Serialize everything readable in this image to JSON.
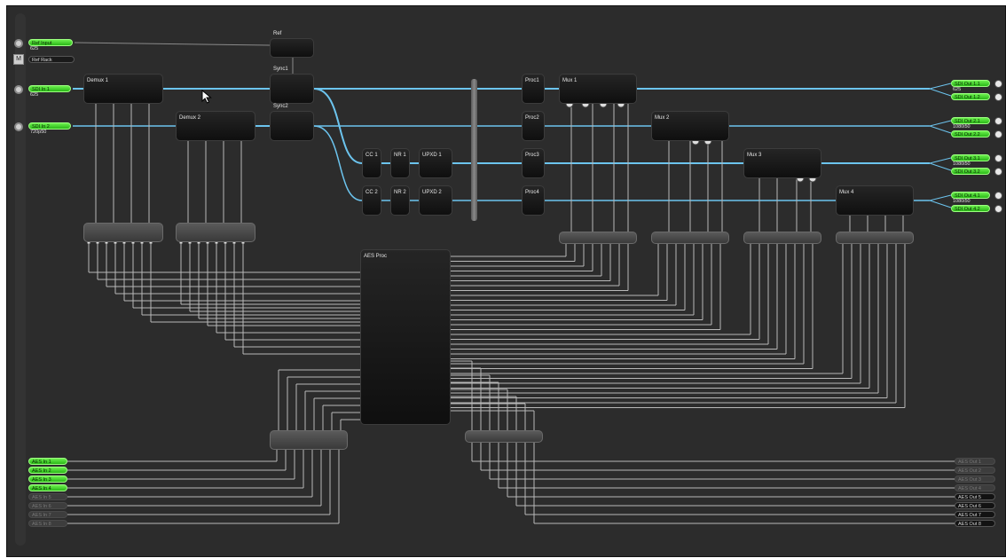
{
  "inputs": {
    "ref_input": {
      "label": "Ref Input",
      "sub": "625"
    },
    "ref_rack": {
      "label": "Ref Rack"
    },
    "sdi_in_1": {
      "label": "SDI In 1",
      "sub": "625"
    },
    "sdi_in_2": {
      "label": "SDI In 2",
      "sub": "720p50"
    }
  },
  "processors": {
    "ref": "Ref",
    "sync1": "Sync1",
    "sync2": "Sync2",
    "demux1": "Demux 1",
    "demux2": "Demux 2",
    "cc1": "CC 1",
    "nr1": "NR 1",
    "upxd1": "UPXD 1",
    "cc2": "CC 2",
    "nr2": "NR 2",
    "upxd2": "UPXD 2",
    "proc1": "Proc1",
    "proc2": "Proc2",
    "proc3": "Proc3",
    "proc4": "Proc4",
    "mux1": "Mux 1",
    "mux2": "Mux 2",
    "mux3": "Mux 3",
    "mux4": "Mux 4",
    "aes_proc": "AES Proc"
  },
  "outputs": [
    {
      "a": "SDI Out 1.1",
      "b": "SDI Out 1.2",
      "sub": "625"
    },
    {
      "a": "SDI Out 2.1",
      "b": "SDI Out 2.2",
      "sub": "1080i50"
    },
    {
      "a": "SDI Out 3.1",
      "b": "SDI Out 3.2",
      "sub": "1080i50"
    },
    {
      "a": "SDI Out 4.1",
      "b": "SDI Out 4.2",
      "sub": "1080i50"
    }
  ],
  "aes_in": [
    "AES In 1",
    "AES In 2",
    "AES In 3",
    "AES In 4",
    "AES In 5",
    "AES In 6",
    "AES In 7",
    "AES In 8"
  ],
  "aes_out": [
    "AES Out 1",
    "AES Out 2",
    "AES Out 3",
    "AES Out 4",
    "AES Out 5",
    "AES Out 6",
    "AES Out 7",
    "AES Out 8"
  ],
  "colors": {
    "video_wire": "#6cc4ee",
    "audio_wire": "#b8b8b8",
    "active_pill": "#4bd82e",
    "canvas": "#2c2c2c"
  }
}
